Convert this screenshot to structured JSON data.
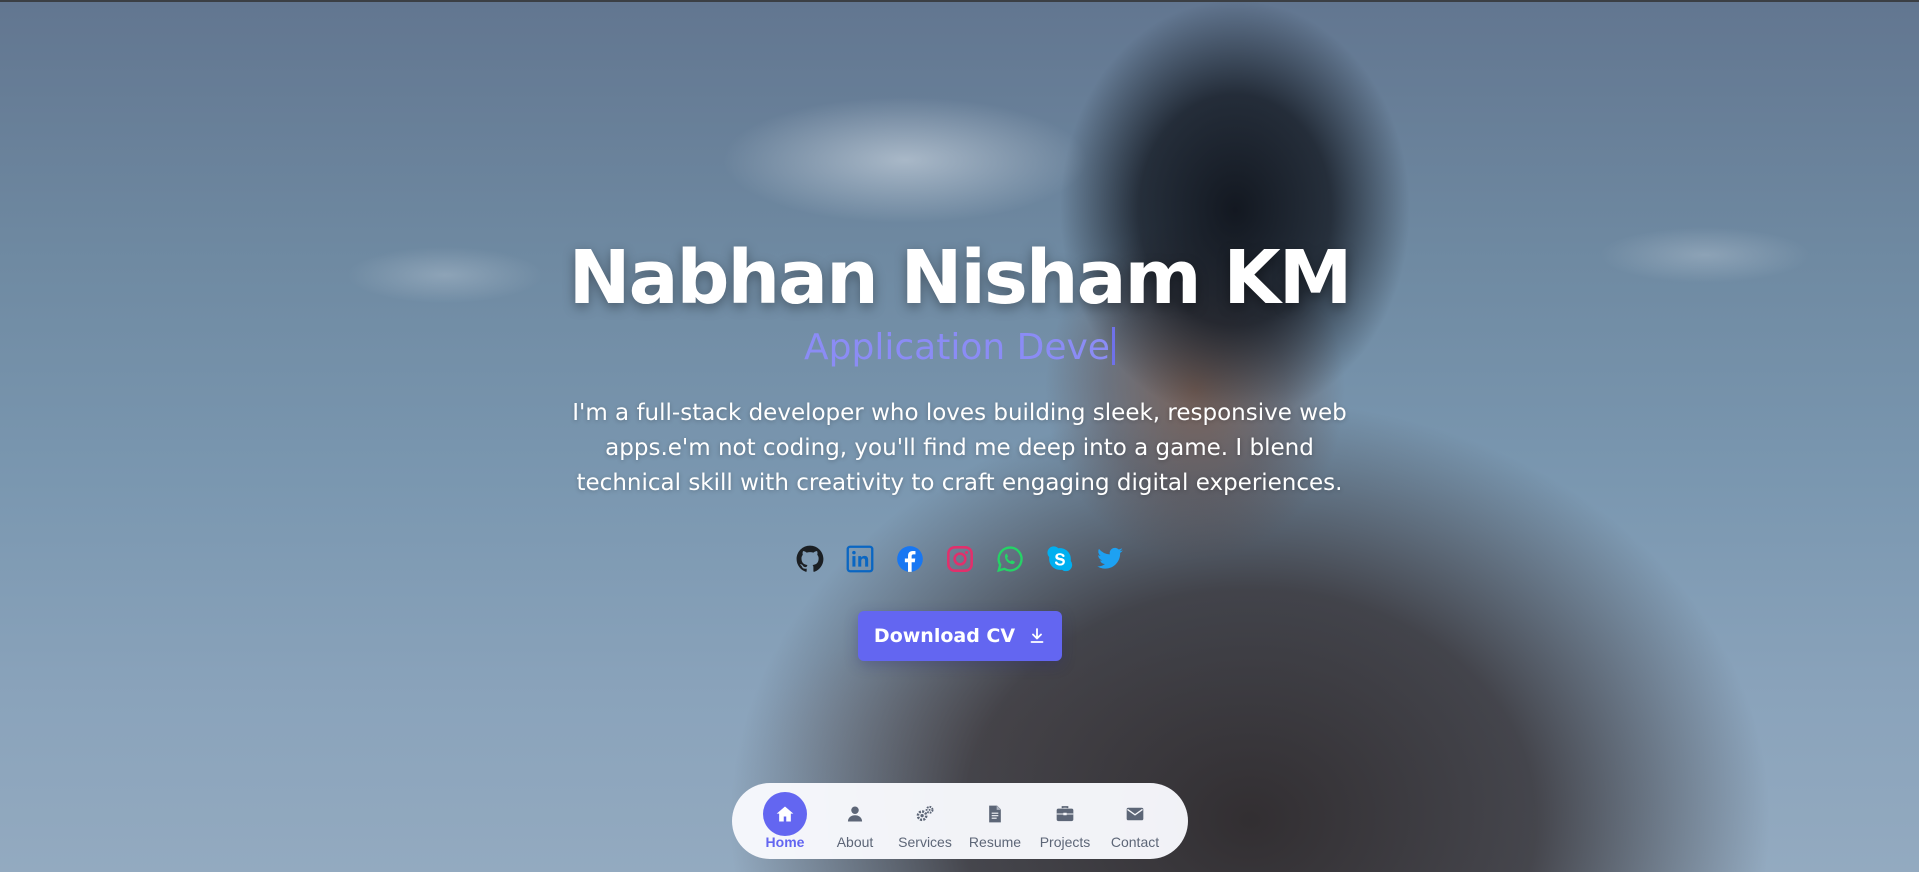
{
  "hero": {
    "name": "Nabhan Nisham KM",
    "role_typed": "Application Deve",
    "bio": "I'm a full-stack developer who loves building sleek, responsive web apps.e'm not coding, you'll find me deep into a game. I blend technical skill with creativity to craft engaging digital experiences."
  },
  "socials": [
    {
      "icon": "github-icon",
      "color": "#1b1f23"
    },
    {
      "icon": "linkedin-icon",
      "color": "#0a66c2"
    },
    {
      "icon": "facebook-icon",
      "color": "#1877f2"
    },
    {
      "icon": "instagram-icon",
      "color": "#e1306c"
    },
    {
      "icon": "whatsapp-icon",
      "color": "#25d366"
    },
    {
      "icon": "skype-icon",
      "color": "#00aff0"
    },
    {
      "icon": "twitter-icon",
      "color": "#1da1f2"
    }
  ],
  "cv_button": {
    "label": "Download CV",
    "icon": "download-icon",
    "color": "#6366f1"
  },
  "nav": {
    "active": "Home",
    "items": [
      {
        "label": "Home",
        "icon": "home-icon"
      },
      {
        "label": "About",
        "icon": "user-icon"
      },
      {
        "label": "Services",
        "icon": "gears-icon"
      },
      {
        "label": "Resume",
        "icon": "document-icon"
      },
      {
        "label": "Projects",
        "icon": "briefcase-icon"
      },
      {
        "label": "Contact",
        "icon": "envelope-icon"
      }
    ]
  }
}
